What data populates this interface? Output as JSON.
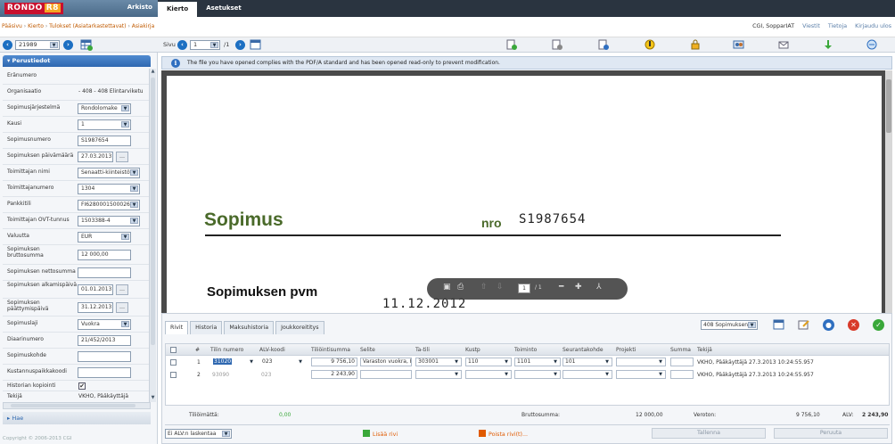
{
  "app": {
    "logo_text": "RONDO",
    "logo_badge": "R8",
    "arkisto_label": "Arkisto",
    "top_tabs": [
      "Kierto",
      "Asetukset"
    ]
  },
  "breadcrumb": [
    "Pääsivu",
    "Kierto",
    "Tulokset (Asiatarkastettavat)",
    "Asiakirja"
  ],
  "user_links": {
    "user": "CGI, SopparIAT",
    "links": [
      "Viestit",
      "Tietoja",
      "Kirjaudu ulos"
    ]
  },
  "left_toolbar": {
    "doc_id": "21989"
  },
  "left_panel": {
    "header": "Perustiedot",
    "fields": [
      {
        "label": "Eränumero",
        "value": ""
      },
      {
        "label": "Organisaatio",
        "value": "- 408 - 408 Elintarviketu"
      },
      {
        "label": "Sopimusjärjestelmä",
        "value": "Rondolomake"
      },
      {
        "label": "Kausi",
        "value": "1"
      },
      {
        "label": "Sopimusnumero",
        "value": "S1987654"
      },
      {
        "label": "Sopimuksen päivämäärä",
        "value": "27.03.2013"
      },
      {
        "label": "Toimittajan nimi",
        "value": "Senaatti-kiinteistöt"
      },
      {
        "label": "Toimittajanumero",
        "value": "1304"
      },
      {
        "label": "Pankkitili",
        "value": "FI628000150002654"
      },
      {
        "label": "Toimittajan OVT-tunnus",
        "value": "1503388-4"
      },
      {
        "label": "Valuutta",
        "value": "EUR"
      },
      {
        "label": "Sopimuksen bruttosumma",
        "value": "12 000,00"
      },
      {
        "label": "Sopimuksen nettosumma",
        "value": ""
      },
      {
        "label": "Sopimuksen alkamispäivä",
        "value": "01.01.2013"
      },
      {
        "label": "Sopimuksen päättymispäivä",
        "value": "31.12.2013"
      },
      {
        "label": "Sopimuslaji",
        "value": "Vuokra"
      },
      {
        "label": "Diaarinumero",
        "value": "21/452/2013"
      },
      {
        "label": "Sopimuskohde",
        "value": ""
      },
      {
        "label": "Kustannuspaikkakoodi",
        "value": ""
      },
      {
        "label": "Historian kopiointi",
        "value": "✔"
      },
      {
        "label": "Tekijä",
        "value": "VKHO, Pääkäyttäjä"
      }
    ],
    "search_label": "Hae",
    "copyright": "Copyright © 2006-2013 CGI"
  },
  "doc_toolbar": {
    "page_label": "Sivu",
    "page_value": "1",
    "page_total": "/1"
  },
  "info_bar": {
    "text": "The file you have opened complies with the PDF/A standard and has been opened read-only to prevent modification."
  },
  "document": {
    "title": "Sopimus",
    "nro_label": "nro",
    "number": "S1987654",
    "subtitle": "Sopimuksen pvm",
    "date": "11.12.2012",
    "pdf_page": "1",
    "pdf_total": "/ 1"
  },
  "grid_panel": {
    "tabs": [
      "Rivit",
      "Historia",
      "Maksuhistoria",
      "Joukkoreititys"
    ],
    "template_select": "408 Sopimuksen tili",
    "columns": [
      "#",
      "Tilin numero",
      "ALV-koodi",
      "Tiliöintisumma",
      "Selite",
      "Ta-tili",
      "Kustp",
      "Toiminto",
      "Seurantakohde",
      "Projekti",
      "Summa",
      "Tekijä"
    ],
    "rows": [
      {
        "n": "1",
        "tili": "31020",
        "alv": "023",
        "summa": "9 756,10",
        "selite": "Varaston vuokra, K",
        "tatili": "303001",
        "kustp": "110",
        "toiminto": "1101",
        "seuranta": "101",
        "projekti": "",
        "summa2": "",
        "tekija": "VKHO, Pääkäyttäjä 27.3.2013 10:24:55.957"
      },
      {
        "n": "2",
        "tili": "93090",
        "alv": "023",
        "summa": "2 243,90",
        "selite": "",
        "tatili": "",
        "kustp": "",
        "toiminto": "",
        "seuranta": "",
        "projekti": "",
        "summa2": "",
        "tekija": "VKHO, Pääkäyttäjä 27.3.2013 10:24:55.957"
      }
    ],
    "totals": {
      "tilioimatta_label": "Tiliöimättä:",
      "tilioimatta_value": "0,00",
      "brutto_label": "Bruttosumma:",
      "brutto_value": "12 000,00",
      "veroton_label": "Veroton:",
      "veroton_value": "9 756,10",
      "alv_label": "ALV:",
      "alv_value": "2 243,90"
    },
    "footer": {
      "alv_select": "Ei ALV:n laskentaa",
      "add_row": "Lisää rivi",
      "delete_rows": "Poista rivi(t)...",
      "save": "Tallenna",
      "cancel": "Peruuta"
    }
  },
  "colors": {
    "top_bar": "#2a3440",
    "logo_red": "#c8102e",
    "accent_blue": "#2f68b0",
    "doc_green": "#4a6a2a",
    "link_orange": "#e05a00"
  }
}
